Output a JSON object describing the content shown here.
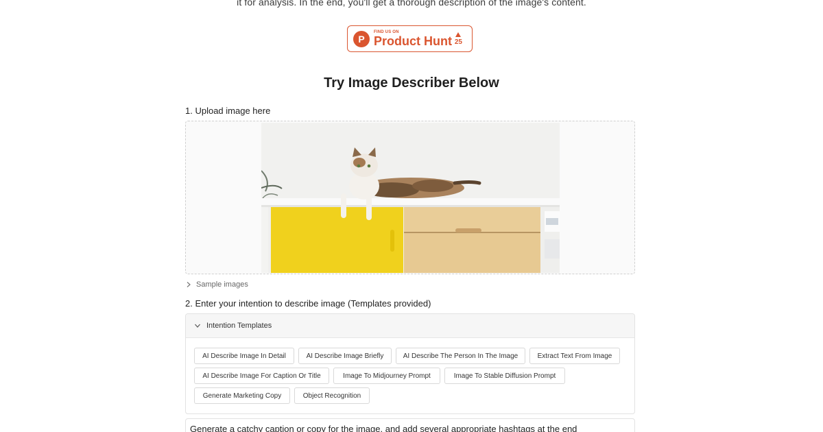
{
  "intro": {
    "text": "it for analysis. In the end, you'll get a thorough description of the image's content."
  },
  "product_hunt": {
    "logo_letter": "P",
    "small_text": "FIND US ON",
    "big_text": "Product Hunt",
    "votes": "25",
    "color": "#da552f"
  },
  "section": {
    "title": "Try Image Describer Below"
  },
  "step1": {
    "label": "1. Upload image here"
  },
  "sample": {
    "label": "Sample images"
  },
  "step2": {
    "label": "2. Enter your intention to describe image (Templates provided)"
  },
  "templates": {
    "header": "Intention Templates",
    "chips": [
      "AI Describe Image In Detail",
      "AI Describe Image Briefly",
      "AI Describe The Person In The Image",
      "Extract Text From Image",
      "AI Describe Image For Caption Or Title",
      "Image To Midjourney Prompt",
      "Image To Stable Diffusion Prompt",
      "Generate Marketing Copy",
      "Object Recognition"
    ]
  },
  "prompt": {
    "value": "Generate a catchy caption or copy for the image, and add several appropriate hashtags at the end"
  }
}
